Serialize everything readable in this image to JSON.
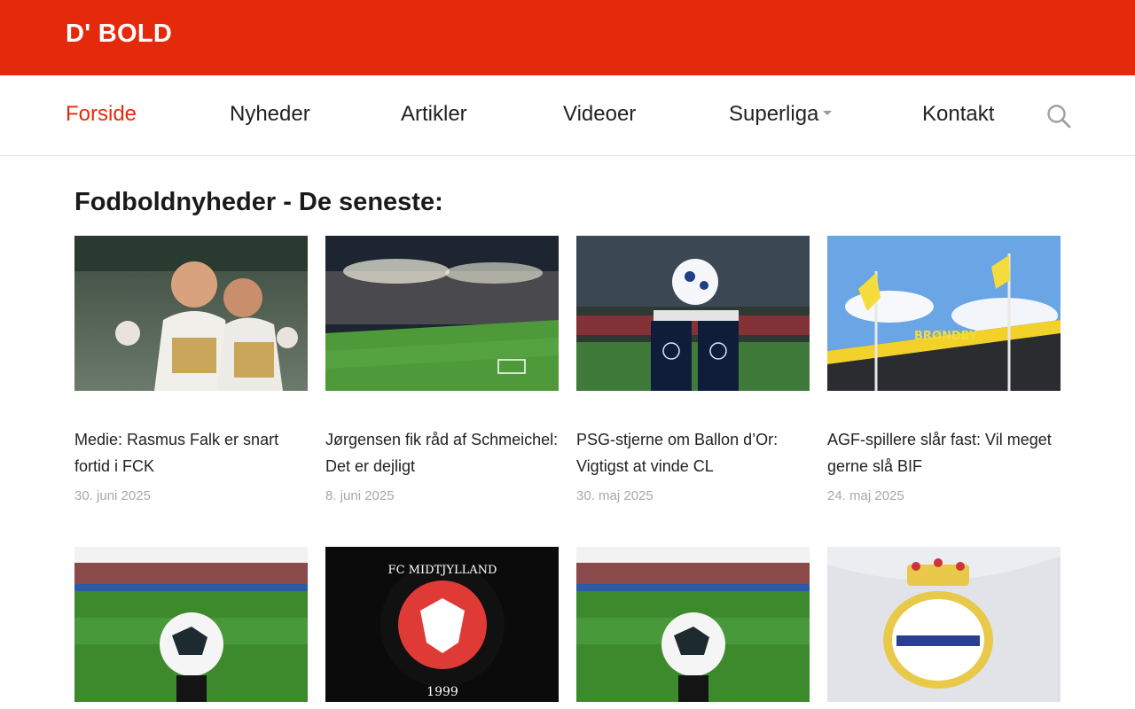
{
  "site": {
    "logo": "D' BOLD",
    "accent_color": "#e52a0c"
  },
  "nav": {
    "items": [
      {
        "label": "Forside",
        "active": true
      },
      {
        "label": "Nyheder"
      },
      {
        "label": "Artikler"
      },
      {
        "label": "Videoer"
      },
      {
        "label": "Superliga",
        "has_dropdown": true
      },
      {
        "label": "Kontakt"
      }
    ],
    "search_icon": "search-icon"
  },
  "main": {
    "heading": "Fodboldnyheder - De seneste:",
    "articles": [
      {
        "title": "Medie: Rasmus Falk er snart fortid i FCK",
        "date": "30. juni 2025",
        "image": "celebrating-players"
      },
      {
        "title": "Jørgensen fik råd af Schmeichel: Det er dejligt",
        "date": "8. juni 2025",
        "image": "stadium-floodlights"
      },
      {
        "title": "PSG-stjerne om Ballon d’Or: Vigtigst at vinde CL",
        "date": "30. maj 2025",
        "image": "champions-league-ball"
      },
      {
        "title": "AGF-spillere slår fast: Vil meget gerne slå BIF",
        "date": "24. maj 2025",
        "image": "brondby-stadium-flags",
        "sign_text": "BRØNDBY"
      },
      {
        "image": "select-ball-on-pitch"
      },
      {
        "image": "fc-midtjylland-crest",
        "crest_text": "FC MIDTJYLLAND",
        "crest_year": "1999"
      },
      {
        "image": "select-ball-on-pitch"
      },
      {
        "image": "real-madrid-crest"
      }
    ]
  }
}
